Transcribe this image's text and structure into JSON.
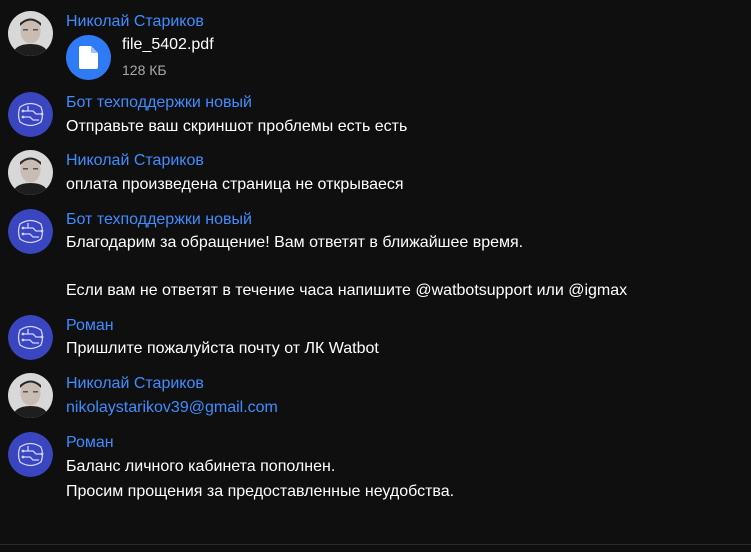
{
  "messages": [
    {
      "author": "Николай Стариков",
      "avatar_icon": "user-photo-avatar",
      "file": {
        "name": "file_5402.pdf",
        "size": "128 КБ",
        "icon": "document-icon",
        "icon_color": "#2f7bf5"
      }
    },
    {
      "author": "Бот техподдержки новый",
      "avatar_icon": "bot-circuit-avatar",
      "lines": [
        "Отправьте ваш скриншот проблемы есть есть"
      ]
    },
    {
      "author": "Николай Стариков",
      "avatar_icon": "user-photo-avatar",
      "lines": [
        "оплата произведена страница не открываеся"
      ]
    },
    {
      "author": "Бот техподдержки новый",
      "avatar_icon": "bot-circuit-avatar",
      "lines": [
        "Благодарим за обращение! Вам ответят в ближайшее время.",
        "Если вам не ответят в течение часа напишите @watbotsupport или @igmax"
      ]
    },
    {
      "author": "Роман",
      "avatar_icon": "bot-circuit-avatar",
      "lines": [
        "Пришлите пожалуйста почту от ЛК Watbot"
      ]
    },
    {
      "author": "Николай Стариков",
      "avatar_icon": "user-photo-avatar",
      "link": "nikolaystarikov39@gmail.com"
    },
    {
      "author": "Роман",
      "avatar_icon": "bot-circuit-avatar",
      "lines": [
        "Баланс личного кабинета пополнен.",
        "Просим прощения за предоставленные неудобства."
      ]
    }
  ],
  "colors": {
    "background": "#0f0f0f",
    "author_name": "#3f8cff",
    "message_text": "#ffffff",
    "link": "#3f8cff",
    "file_size": "#a8a8a8",
    "bot_avatar": "#3a46c0"
  }
}
